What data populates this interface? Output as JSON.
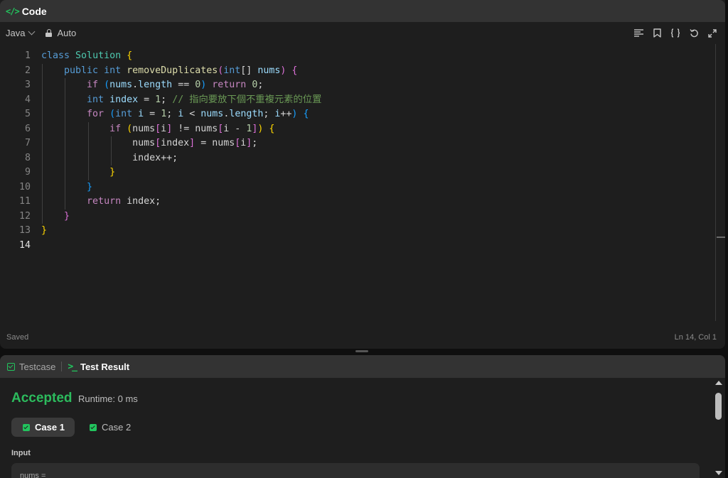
{
  "code_panel": {
    "title": "Code",
    "language": "Java",
    "mode": "Auto",
    "icons": [
      "format-icon",
      "bookmark-icon",
      "braces-icon",
      "reset-icon",
      "expand-icon"
    ],
    "status_saved": "Saved",
    "cursor_position": "Ln 14, Col 1"
  },
  "editor": {
    "line_numbers": [
      "1",
      "2",
      "3",
      "4",
      "5",
      "6",
      "7",
      "8",
      "9",
      "10",
      "11",
      "12",
      "13",
      "14"
    ],
    "active_line": "14",
    "lines": [
      [
        [
          "class",
          "kw"
        ],
        [
          " ",
          ""
        ],
        [
          "Solution",
          "cls"
        ],
        [
          " ",
          ""
        ],
        [
          "{",
          "br1"
        ]
      ],
      [
        [
          "    ",
          ""
        ],
        [
          "public",
          "kw"
        ],
        [
          " ",
          ""
        ],
        [
          "int",
          "kw"
        ],
        [
          " ",
          ""
        ],
        [
          "removeDuplicates",
          "fn"
        ],
        [
          "(",
          "br2"
        ],
        [
          "int",
          "kw"
        ],
        [
          "[] ",
          ""
        ],
        [
          "nums",
          "var"
        ],
        [
          ")",
          "br2"
        ],
        [
          " ",
          ""
        ],
        [
          "{",
          "br2"
        ]
      ],
      [
        [
          "        ",
          ""
        ],
        [
          "if",
          "ctl"
        ],
        [
          " ",
          ""
        ],
        [
          "(",
          "br3"
        ],
        [
          "nums",
          "var"
        ],
        [
          ".",
          ""
        ],
        [
          "length",
          "var"
        ],
        [
          " == ",
          ""
        ],
        [
          "0",
          "num"
        ],
        [
          ")",
          "br3"
        ],
        [
          " ",
          ""
        ],
        [
          "return",
          "ctl"
        ],
        [
          " ",
          ""
        ],
        [
          "0",
          "num"
        ],
        [
          ";",
          ""
        ]
      ],
      [
        [
          "        ",
          ""
        ],
        [
          "int",
          "kw"
        ],
        [
          " ",
          ""
        ],
        [
          "index",
          "var"
        ],
        [
          " = ",
          ""
        ],
        [
          "1",
          "num"
        ],
        [
          "; ",
          ""
        ],
        [
          "// 指向要放下個不重複元素的位置",
          "cm"
        ]
      ],
      [
        [
          "        ",
          ""
        ],
        [
          "for",
          "ctl"
        ],
        [
          " ",
          ""
        ],
        [
          "(",
          "br3"
        ],
        [
          "int",
          "kw"
        ],
        [
          " ",
          ""
        ],
        [
          "i",
          "var"
        ],
        [
          " = ",
          ""
        ],
        [
          "1",
          "num"
        ],
        [
          "; ",
          ""
        ],
        [
          "i",
          "var"
        ],
        [
          " < ",
          ""
        ],
        [
          "nums",
          "var"
        ],
        [
          ".",
          ""
        ],
        [
          "length",
          "var"
        ],
        [
          "; ",
          ""
        ],
        [
          "i",
          "var"
        ],
        [
          "++",
          ""
        ],
        [
          ")",
          "br3"
        ],
        [
          " ",
          ""
        ],
        [
          "{",
          "br3"
        ]
      ],
      [
        [
          "            ",
          ""
        ],
        [
          "if",
          "ctl"
        ],
        [
          " ",
          ""
        ],
        [
          "(",
          "br1"
        ],
        [
          "nums",
          ""
        ],
        [
          "[",
          "br2"
        ],
        [
          "i",
          ""
        ],
        [
          "]",
          "br2"
        ],
        [
          " != ",
          ""
        ],
        [
          "nums",
          ""
        ],
        [
          "[",
          "br2"
        ],
        [
          "i - ",
          ""
        ],
        [
          "1",
          "num"
        ],
        [
          "]",
          "br2"
        ],
        [
          ")",
          "br1"
        ],
        [
          " ",
          ""
        ],
        [
          "{",
          "br1"
        ]
      ],
      [
        [
          "                ",
          ""
        ],
        [
          "nums",
          ""
        ],
        [
          "[",
          "br2"
        ],
        [
          "index",
          ""
        ],
        [
          "]",
          "br2"
        ],
        [
          " = ",
          ""
        ],
        [
          "nums",
          ""
        ],
        [
          "[",
          "br2"
        ],
        [
          "i",
          ""
        ],
        [
          "]",
          "br2"
        ],
        [
          ";",
          ""
        ]
      ],
      [
        [
          "                ",
          ""
        ],
        [
          "index++;",
          ""
        ]
      ],
      [
        [
          "            ",
          ""
        ],
        [
          "}",
          "br1"
        ]
      ],
      [
        [
          "        ",
          ""
        ],
        [
          "}",
          "br3"
        ]
      ],
      [
        [
          "        ",
          ""
        ],
        [
          "return",
          "ctl"
        ],
        [
          " ",
          ""
        ],
        [
          "index",
          ""
        ],
        [
          ";",
          ""
        ]
      ],
      [
        [
          "    ",
          ""
        ],
        [
          "}",
          "br2"
        ]
      ],
      [
        [
          "}",
          "br1"
        ]
      ],
      [
        [
          "",
          ""
        ]
      ]
    ]
  },
  "result_panel": {
    "tabs": [
      {
        "label": "Testcase",
        "icon": "checkbox-icon",
        "active": false
      },
      {
        "label": "Test Result",
        "icon": "terminal-icon",
        "active": true
      }
    ],
    "verdict": "Accepted",
    "runtime": "Runtime: 0 ms",
    "cases": [
      {
        "label": "Case 1",
        "active": true
      },
      {
        "label": "Case 2",
        "active": false
      }
    ],
    "input_label": "Input",
    "input_param": "nums ="
  },
  "colors": {
    "accent_green": "#2cbb5d",
    "panel_bg": "#1e1e1e",
    "header_bg": "#333333"
  }
}
